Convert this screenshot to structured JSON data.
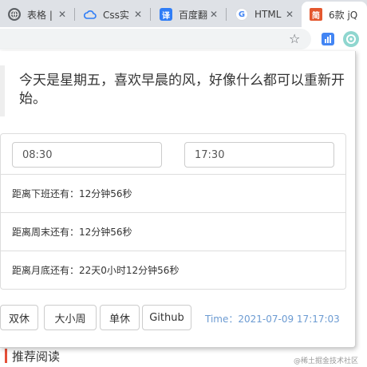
{
  "browser": {
    "tabs": [
      {
        "title": "表格 |",
        "icon": "globe-icon",
        "icon_color": "#5f6368",
        "active": false
      },
      {
        "title": "Css实",
        "icon": "cloud-icon",
        "icon_color": "#2f7df6",
        "active": false
      },
      {
        "title": "百度翻",
        "icon": "translate-icon",
        "icon_color": "#2f7df6",
        "icon_text": "译",
        "active": false
      },
      {
        "title": "HTML",
        "icon": "google-icon",
        "icon_color": "#4285f4",
        "icon_text": "G",
        "active": false
      },
      {
        "title": "6款 jQ",
        "icon": "site-icon",
        "icon_color": "#e4572e",
        "icon_text": "简",
        "active": true
      }
    ],
    "close_glyph": "✕",
    "star_glyph": "☆"
  },
  "popup": {
    "quote": "今天是星期五，喜欢早晨的风，好像什么都可以重新开始。",
    "start_time": "08:30",
    "end_time": "17:30",
    "rows": [
      {
        "text": "距离下班还有：12分钟56秒"
      },
      {
        "text": "距离周末还有：12分钟56秒"
      },
      {
        "text": "距离月底还有：22天0小时12分钟56秒"
      }
    ],
    "buttons": [
      {
        "label": "双休"
      },
      {
        "label": "大小周"
      },
      {
        "label": "单休"
      },
      {
        "label": "Github"
      }
    ],
    "clock": "Time：2021-07-09 17:17:03"
  },
  "page": {
    "section_title": "推荐阅读",
    "watermark": "@稀土掘金技术社区"
  },
  "colors": {
    "accent_clock": "#6c9bd2",
    "section_bar": "#e55039"
  }
}
